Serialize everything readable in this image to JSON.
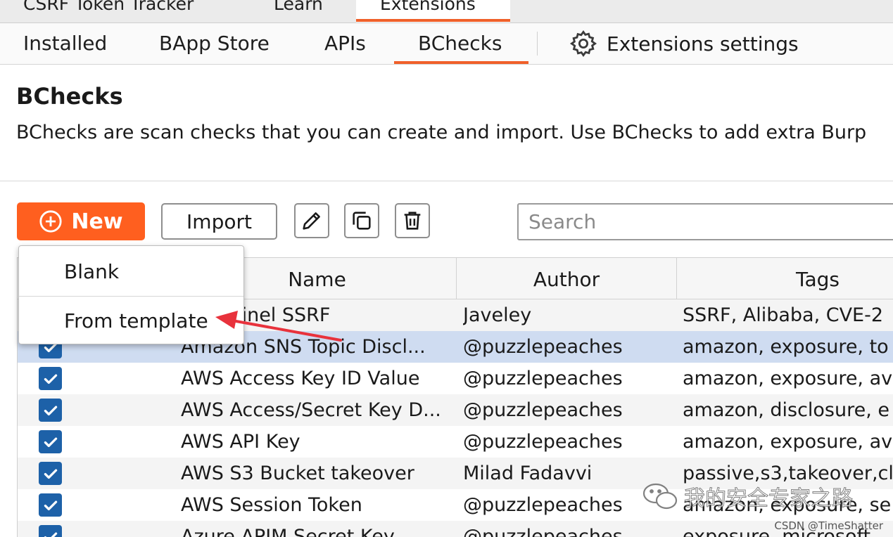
{
  "top_tabs": [
    {
      "label": "CSRF Token Tracker"
    },
    {
      "label": "Learn"
    },
    {
      "label": "Extensions",
      "active": true
    }
  ],
  "sub_tabs": [
    {
      "label": "Installed"
    },
    {
      "label": "BApp Store"
    },
    {
      "label": "APIs"
    },
    {
      "label": "BChecks",
      "active": true
    }
  ],
  "settings_label": "Extensions settings",
  "section": {
    "title": "BChecks",
    "description": "BChecks are scan checks that you can create and import. Use BChecks to add extra Burp"
  },
  "toolbar": {
    "new_label": "New",
    "import_label": "Import",
    "icons": [
      "pencil-icon",
      "copy-icon",
      "trash-icon"
    ],
    "search_placeholder": "Search"
  },
  "dropdown": {
    "items": [
      "Blank",
      "From template"
    ]
  },
  "table": {
    "columns": [
      "Name",
      "Author",
      "Tags"
    ],
    "rows": [
      {
        "name": "a Sentinel SSRF",
        "author": "Javeley",
        "tags": "SSRF, Alibaba, CVE-2"
      },
      {
        "name": "Amazon SNS Topic Discl...",
        "author": "@puzzlepeaches",
        "tags": "amazon, exposure, to",
        "selected": true
      },
      {
        "name": "AWS Access Key ID Value",
        "author": "@puzzlepeaches",
        "tags": "amazon, exposure, av"
      },
      {
        "name": "AWS Access/Secret Key D...",
        "author": "@puzzlepeaches",
        "tags": "amazon, disclosure, e"
      },
      {
        "name": "AWS API Key",
        "author": "@puzzlepeaches",
        "tags": "amazon, exposure, av"
      },
      {
        "name": "AWS S3 Bucket takeover",
        "author": "Milad Fadavvi",
        "tags": "passive,s3,takeover,cl"
      },
      {
        "name": "AWS Session Token",
        "author": "@puzzlepeaches",
        "tags": "amazon, exposure, se"
      },
      {
        "name": "Azure APIM Secret Key",
        "author": "@puzzlepeaches",
        "tags": "exposure, microsoft"
      }
    ]
  },
  "watermark": "我的安全专家之路",
  "csdn_credit": "CSDN @TimeShatter",
  "colors": {
    "accent": "#ff5f1f",
    "tab_underline": "#f0602a",
    "checkbox": "#1d61a8",
    "selected_row": "#cfdcf1",
    "arrow": "#e8323c"
  }
}
